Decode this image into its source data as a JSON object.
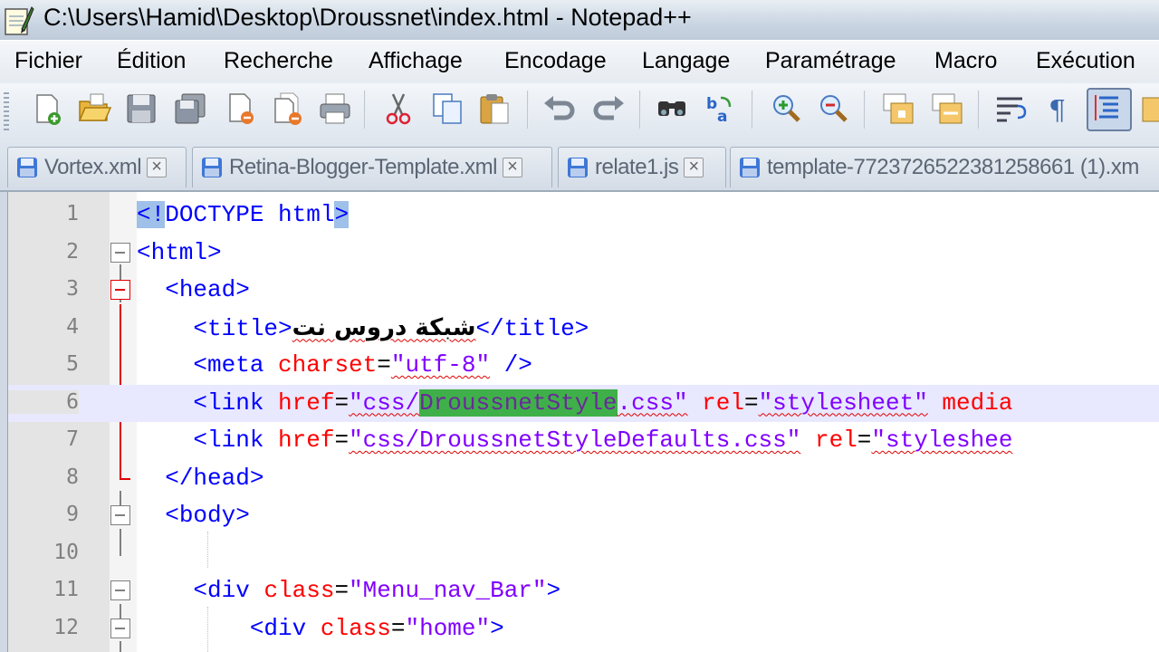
{
  "window": {
    "title": "C:\\Users\\Hamid\\Desktop\\Droussnet\\index.html - Notepad++"
  },
  "menu": [
    {
      "label": "Fichier"
    },
    {
      "label": "Édition"
    },
    {
      "label": "Recherche"
    },
    {
      "label": "Affichage"
    },
    {
      "label": "Encodage"
    },
    {
      "label": "Langage"
    },
    {
      "label": "Paramétrage"
    },
    {
      "label": "Macro"
    },
    {
      "label": "Exécution"
    }
  ],
  "toolbar": {
    "buttons": [
      "new-file-icon",
      "open-file-icon",
      "save-icon",
      "save-all-icon",
      "close-icon",
      "close-all-icon",
      "print-icon",
      "cut-icon",
      "copy-icon",
      "paste-icon",
      "undo-icon",
      "redo-icon",
      "find-icon",
      "replace-icon",
      "zoom-in-icon",
      "zoom-out-icon",
      "sync-vertical-icon",
      "sync-horizontal-icon",
      "word-wrap-icon",
      "show-all-characters-icon",
      "indent-guide-icon",
      "user-language-icon"
    ]
  },
  "tabs": [
    {
      "label": "Vortex.xml",
      "active": false
    },
    {
      "label": "Retina-Blogger-Template.xml",
      "active": false
    },
    {
      "label": "relate1.js",
      "active": false
    },
    {
      "label": "template-7723726522381258661 (1).xm",
      "active": false
    }
  ],
  "editor": {
    "current_line": 6,
    "lines": [
      {
        "n": "1"
      },
      {
        "n": "2"
      },
      {
        "n": "3"
      },
      {
        "n": "4"
      },
      {
        "n": "5"
      },
      {
        "n": "6"
      },
      {
        "n": "7"
      },
      {
        "n": "8"
      },
      {
        "n": "9"
      },
      {
        "n": "10"
      },
      {
        "n": "11"
      },
      {
        "n": "12"
      }
    ],
    "code": {
      "l1_open": "<!",
      "l1_mid": "DOCTYPE html",
      "l1_close": ">",
      "l2_tag": "<html>",
      "l3_tag": "<head>",
      "l4_open": "<title>",
      "l4_text": "شبكة دروس نت",
      "l4_close": "</title>",
      "l5_tag": "<meta",
      "l5_attr": "charset",
      "l5_eq": "=",
      "l5_val": "\"utf-8\"",
      "l5_end": "/>",
      "l6_tag": "<link",
      "l6_attr1": "href",
      "l6_eq": "=",
      "l6_val_a": "\"css/",
      "l6_val_sel": "DroussnetStyle",
      "l6_val_b": ".css\"",
      "l6_attr2": "rel",
      "l6_val2": "\"stylesheet\"",
      "l6_attr3": "media",
      "l7_tag": "<link",
      "l7_attr1": "href",
      "l7_val1": "\"css/DroussnetStyleDefaults.css\"",
      "l7_attr2": "rel",
      "l7_val2": "\"styleshee",
      "l8_tag": "</head>",
      "l9_tag": "<body>",
      "l11_tag": "<div",
      "l11_attr": "class",
      "l11_val": "\"Menu_nav_Bar\"",
      "l11_end": ">",
      "l12_tag": "<div",
      "l12_attr": "class",
      "l12_val": "\"home\"",
      "l12_end": ">"
    }
  },
  "colors": {
    "tag": "#0000ff",
    "attribute": "#ff0000",
    "string": "#8000ff",
    "selection": "#3fb049",
    "current_line": "#e8e8ff",
    "fold_active": "#e00000"
  }
}
